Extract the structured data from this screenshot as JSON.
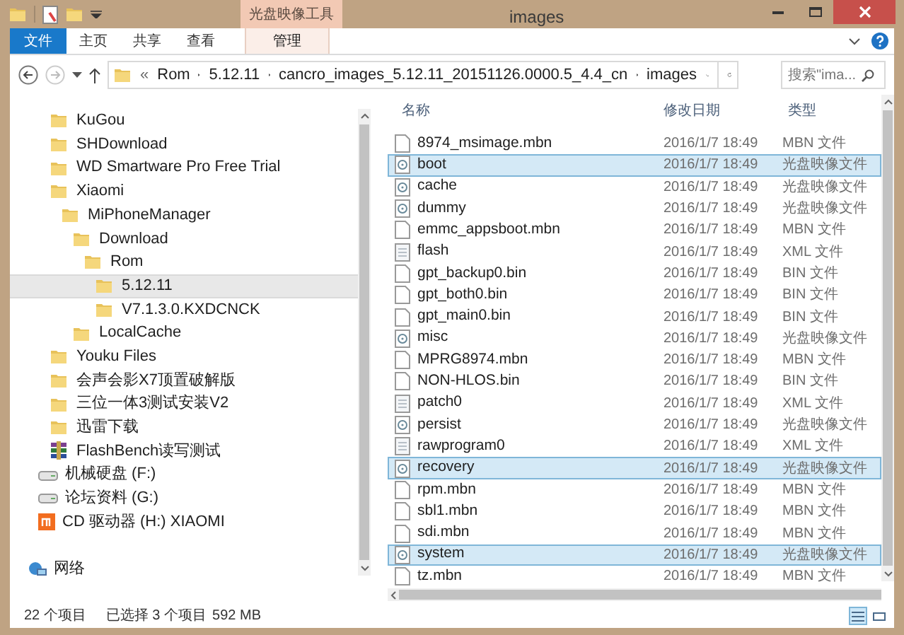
{
  "window": {
    "title": "images",
    "context_tab": "光盘映像工具"
  },
  "ribbon": {
    "tabs": [
      {
        "label": "文件",
        "kind": "file",
        "selected": false
      },
      {
        "label": "主页",
        "kind": "tab",
        "selected": false
      },
      {
        "label": "共享",
        "kind": "tab",
        "selected": false
      },
      {
        "label": "查看",
        "kind": "tab",
        "selected": false
      },
      {
        "label": "管理",
        "kind": "context",
        "selected": false
      }
    ]
  },
  "address": {
    "overflow": "«",
    "crumbs": [
      "Rom",
      "5.12.11",
      "cancro_images_5.12.11_20151126.0000.5_4.4_cn",
      "images"
    ],
    "search_placeholder": "搜索\"ima..."
  },
  "nav": {
    "folders": [
      {
        "label": "KuGou",
        "kind": "folder",
        "selected": false
      },
      {
        "label": "SHDownload",
        "kind": "folder",
        "selected": false
      },
      {
        "label": "WD Smartware Pro Free Trial",
        "kind": "folder",
        "selected": false
      },
      {
        "label": "Xiaomi",
        "kind": "folder",
        "selected": false,
        "children": [
          {
            "label": "MiPhoneManager",
            "kind": "folder",
            "selected": false,
            "children": [
              {
                "label": "Download",
                "kind": "folder",
                "selected": false,
                "children": [
                  {
                    "label": "Rom",
                    "kind": "folder",
                    "selected": false,
                    "children": [
                      {
                        "label": "5.12.11",
                        "kind": "folder",
                        "selected": true
                      },
                      {
                        "label": "V7.1.3.0.KXDCNCK",
                        "kind": "folder",
                        "selected": false
                      }
                    ]
                  }
                ]
              },
              {
                "label": "LocalCache",
                "kind": "folder",
                "selected": false
              }
            ]
          }
        ]
      },
      {
        "label": "Youku Files",
        "kind": "folder",
        "selected": false
      },
      {
        "label": "会声会影X7顶置破解版",
        "kind": "folder",
        "selected": false
      },
      {
        "label": "三位一体3测试安装V2",
        "kind": "folder",
        "selected": false
      },
      {
        "label": "迅雷下载",
        "kind": "folder",
        "selected": false
      },
      {
        "label": "FlashBench读写测试",
        "kind": "archive",
        "selected": false
      }
    ],
    "drives": [
      {
        "label": "机械硬盘 (F:)",
        "kind": "disk"
      },
      {
        "label": "论坛资料 (G:)",
        "kind": "disk"
      },
      {
        "label": "CD 驱动器 (H:) XIAOMI",
        "kind": "cd"
      }
    ],
    "network": {
      "label": "网络"
    }
  },
  "columns": [
    "名称",
    "修改日期",
    "类型"
  ],
  "files": [
    {
      "name": "8974_msimage.mbn",
      "date": "2016/1/7 18:49",
      "type": "MBN 文件",
      "kind": "file",
      "selected": false
    },
    {
      "name": "boot",
      "date": "2016/1/7 18:49",
      "type": "光盘映像文件",
      "kind": "image",
      "selected": true
    },
    {
      "name": "cache",
      "date": "2016/1/7 18:49",
      "type": "光盘映像文件",
      "kind": "image",
      "selected": false
    },
    {
      "name": "dummy",
      "date": "2016/1/7 18:49",
      "type": "光盘映像文件",
      "kind": "image",
      "selected": false
    },
    {
      "name": "emmc_appsboot.mbn",
      "date": "2016/1/7 18:49",
      "type": "MBN 文件",
      "kind": "file",
      "selected": false
    },
    {
      "name": "flash",
      "date": "2016/1/7 18:49",
      "type": "XML 文件",
      "kind": "xml",
      "selected": false
    },
    {
      "name": "gpt_backup0.bin",
      "date": "2016/1/7 18:49",
      "type": "BIN 文件",
      "kind": "file",
      "selected": false
    },
    {
      "name": "gpt_both0.bin",
      "date": "2016/1/7 18:49",
      "type": "BIN 文件",
      "kind": "file",
      "selected": false
    },
    {
      "name": "gpt_main0.bin",
      "date": "2016/1/7 18:49",
      "type": "BIN 文件",
      "kind": "file",
      "selected": false
    },
    {
      "name": "misc",
      "date": "2016/1/7 18:49",
      "type": "光盘映像文件",
      "kind": "image",
      "selected": false
    },
    {
      "name": "MPRG8974.mbn",
      "date": "2016/1/7 18:49",
      "type": "MBN 文件",
      "kind": "file",
      "selected": false
    },
    {
      "name": "NON-HLOS.bin",
      "date": "2016/1/7 18:49",
      "type": "BIN 文件",
      "kind": "file",
      "selected": false
    },
    {
      "name": "patch0",
      "date": "2016/1/7 18:49",
      "type": "XML 文件",
      "kind": "xml",
      "selected": false
    },
    {
      "name": "persist",
      "date": "2016/1/7 18:49",
      "type": "光盘映像文件",
      "kind": "image",
      "selected": false
    },
    {
      "name": "rawprogram0",
      "date": "2016/1/7 18:49",
      "type": "XML 文件",
      "kind": "xml",
      "selected": false
    },
    {
      "name": "recovery",
      "date": "2016/1/7 18:49",
      "type": "光盘映像文件",
      "kind": "image",
      "selected": true
    },
    {
      "name": "rpm.mbn",
      "date": "2016/1/7 18:49",
      "type": "MBN 文件",
      "kind": "file",
      "selected": false
    },
    {
      "name": "sbl1.mbn",
      "date": "2016/1/7 18:49",
      "type": "MBN 文件",
      "kind": "file",
      "selected": false
    },
    {
      "name": "sdi.mbn",
      "date": "2016/1/7 18:49",
      "type": "MBN 文件",
      "kind": "file",
      "selected": false
    },
    {
      "name": "system",
      "date": "2016/1/7 18:49",
      "type": "光盘映像文件",
      "kind": "image",
      "selected": true
    },
    {
      "name": "tz.mbn",
      "date": "2016/1/7 18:49",
      "type": "MBN 文件",
      "kind": "file",
      "selected": false
    }
  ],
  "status": {
    "count": "22 个项目",
    "selection": "已选择 3 个项目",
    "size": "592 MB"
  },
  "view": [
    {
      "kind": "details",
      "selected": true
    },
    {
      "kind": "tiles",
      "selected": false
    }
  ]
}
